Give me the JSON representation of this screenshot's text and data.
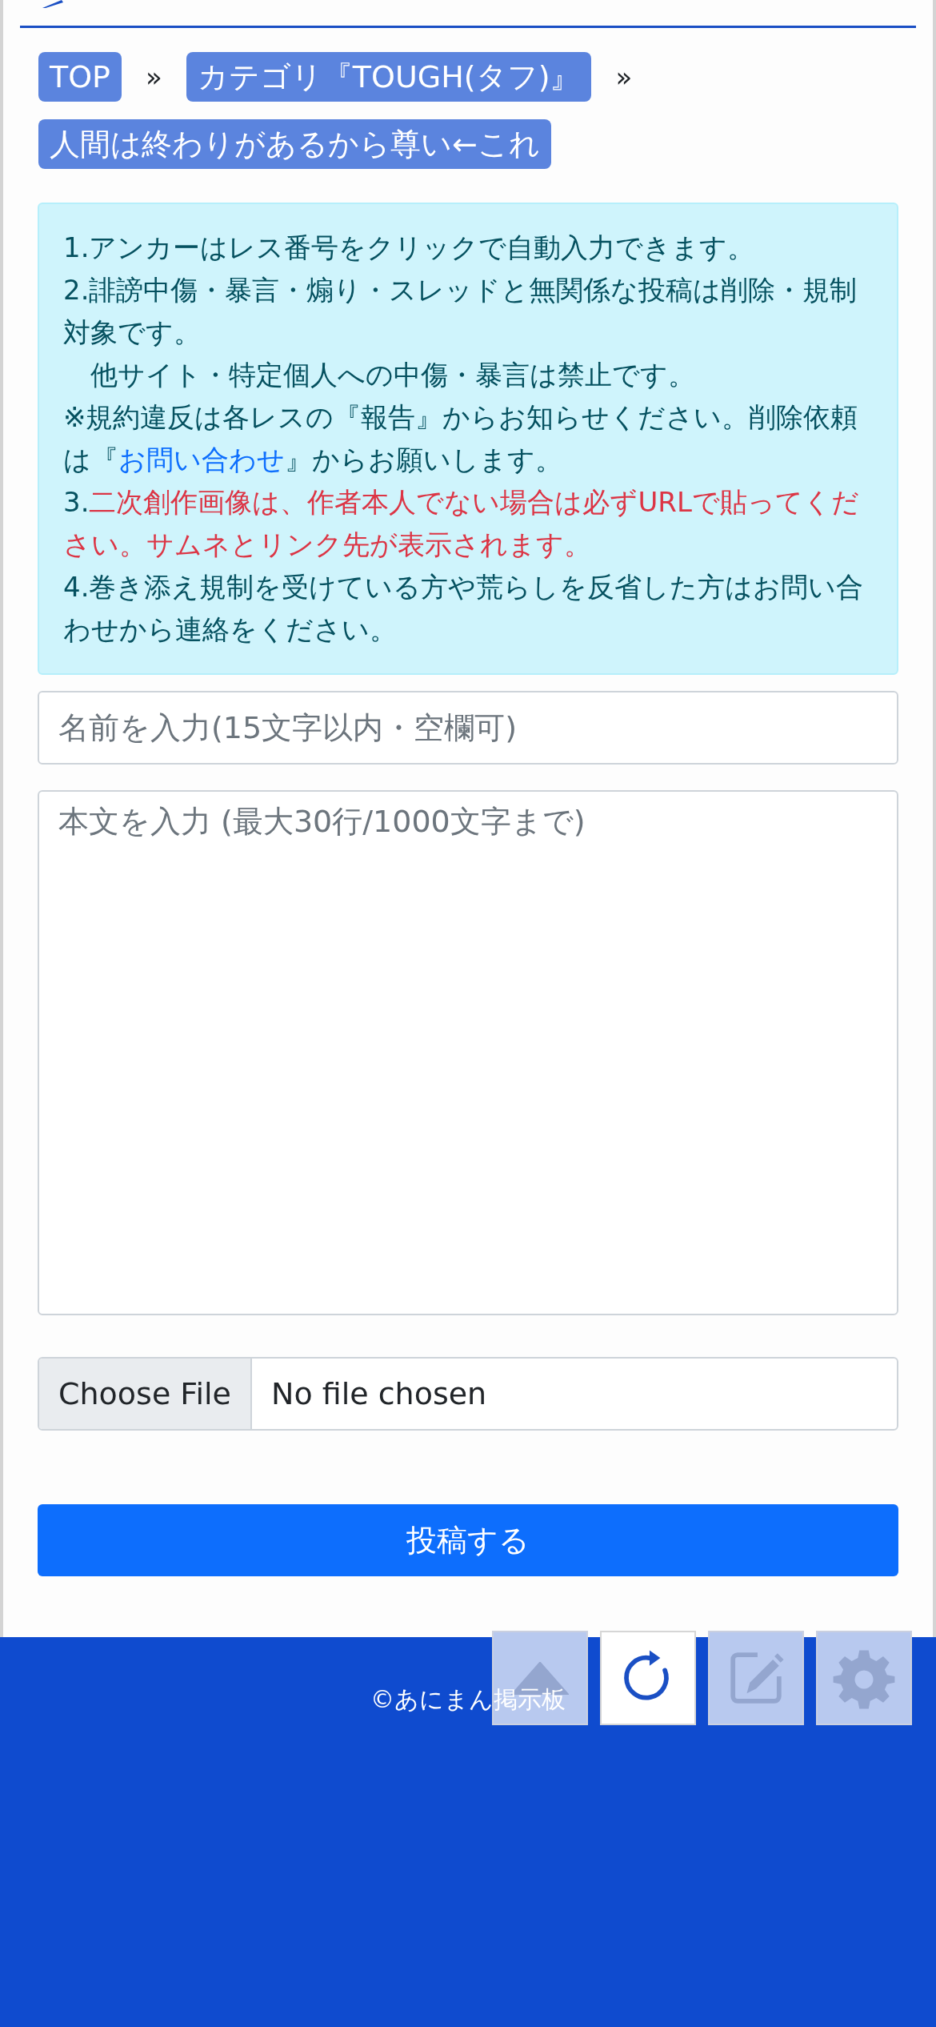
{
  "breadcrumbs": [
    {
      "label": "TOP"
    },
    {
      "label": "カテゴリ『TOUGH(タフ)』"
    },
    {
      "label": "人間は終わりがあるから尊い←これ"
    }
  ],
  "breadcrumb_separator": "»",
  "notice": [
    {
      "segments": [
        {
          "kind": "text",
          "text": "1.アンカーはレス番号をクリックで自動入力できます。"
        }
      ]
    },
    {
      "segments": [
        {
          "kind": "text",
          "text": "2.誹謗中傷・暴言・煽り・スレッドと無関係な投稿は削除・規制対象です。"
        }
      ]
    },
    {
      "segments": [
        {
          "kind": "text",
          "text": "　他サイト・特定個人への中傷・暴言は禁止です。"
        }
      ]
    },
    {
      "segments": [
        {
          "kind": "text",
          "text": "※規約違反は各レスの『報告』からお知らせください。削除依頼は『"
        },
        {
          "kind": "link",
          "text": "お問い合わせ"
        },
        {
          "kind": "text",
          "text": "』からお願いします。"
        }
      ]
    },
    {
      "segments": [
        {
          "kind": "text",
          "text": "3."
        },
        {
          "kind": "warning",
          "text": "二次創作画像は、作者本人でない場合は必ずURLで貼ってください。サムネとリンク先が表示されます。"
        }
      ]
    },
    {
      "segments": [
        {
          "kind": "text",
          "text": "4.巻き添え規制を受けている方や荒らしを反省した方はお問い合わせから連絡をください。"
        }
      ]
    }
  ],
  "name_field": {
    "placeholder": "名前を入力(15文字以内・空欄可)"
  },
  "body_field": {
    "placeholder": "本文を入力 (最大30行/1000文字まで)"
  },
  "file_input": {
    "button": "Choose File",
    "status": "No file chosen"
  },
  "submit": "投稿する",
  "footer": "©あにまん掲示板",
  "float_buttons": [
    {
      "kind": "up",
      "active": false
    },
    {
      "kind": "reload",
      "active": true
    },
    {
      "kind": "edit",
      "active": false
    },
    {
      "kind": "settings",
      "active": false
    }
  ]
}
